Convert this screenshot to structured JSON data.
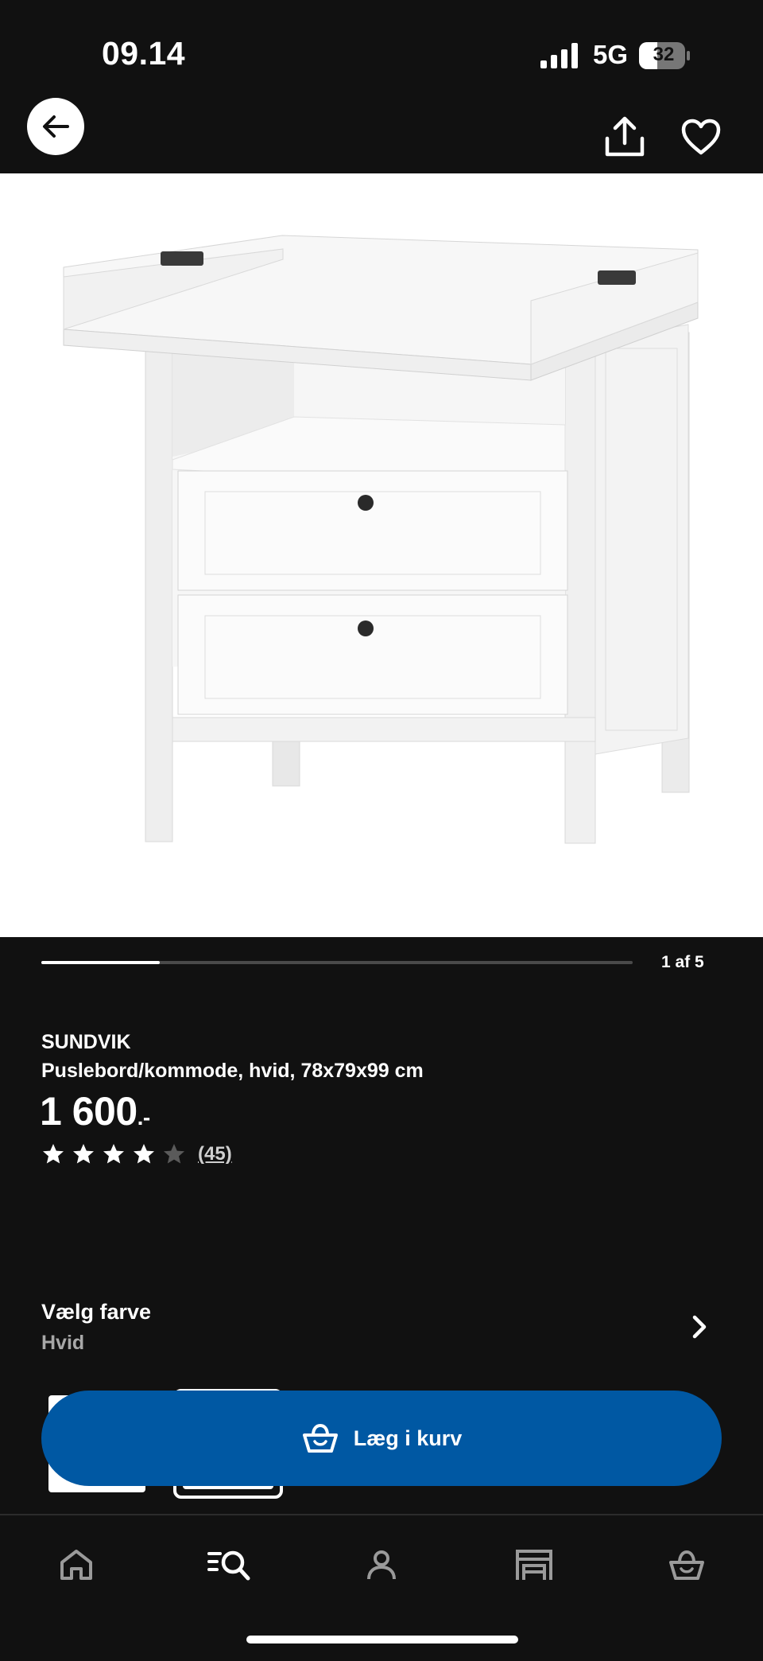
{
  "status_bar": {
    "time": "09.14",
    "network": "5G",
    "battery": "32"
  },
  "header": {
    "back_icon": "arrow-left-icon",
    "share_icon": "share-icon",
    "favorite_icon": "heart-icon"
  },
  "gallery": {
    "counter": "1 af 5",
    "current_index": 1,
    "total": 5
  },
  "product": {
    "name": "SUNDVIK",
    "description": "Puslebord/kommode, hvid, 78x79x99 cm",
    "price": "1 600",
    "price_suffix": ".-",
    "rating": 4.0,
    "rating_max": 5,
    "reviews": "(45)"
  },
  "color": {
    "label": "Vælg farve",
    "value": "Hvid"
  },
  "cart": {
    "label": "Læg i kurv",
    "color": "#0058a3"
  },
  "nav": {
    "items": [
      "home-icon",
      "search-icon",
      "profile-icon",
      "store-icon",
      "cart-icon"
    ],
    "active": "search-icon"
  }
}
